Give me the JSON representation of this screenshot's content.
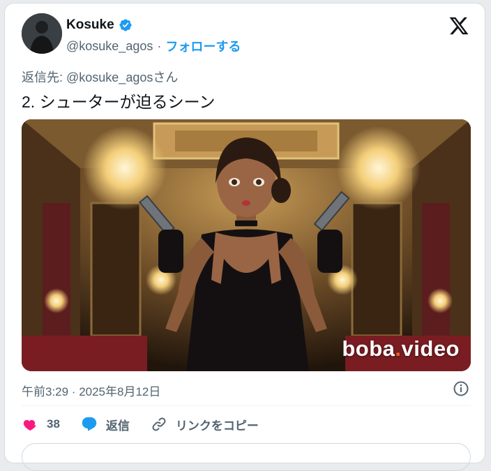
{
  "author": {
    "display_name": "Kosuke",
    "handle": "@kosuke_agos",
    "separator": "·",
    "follow_label": "フォローする"
  },
  "reply_to": "返信先: @kosuke_agosさん",
  "tweet_text": "2. シューターが迫るシーン",
  "media": {
    "watermark_brand_a": "boba",
    "watermark_dot": ".",
    "watermark_brand_b": "video"
  },
  "timestamp": "午前3:29 · 2025年8月12日",
  "actions": {
    "like_count": "38",
    "reply_label": "返信",
    "copy_link_label": "リンクをコピー"
  },
  "colors": {
    "accent": "#1d9bf0",
    "like": "#f91880",
    "muted": "#536471"
  },
  "icons": [
    "verified-badge-icon",
    "x-logo-icon",
    "info-icon",
    "heart-icon",
    "reply-icon",
    "link-icon"
  ]
}
